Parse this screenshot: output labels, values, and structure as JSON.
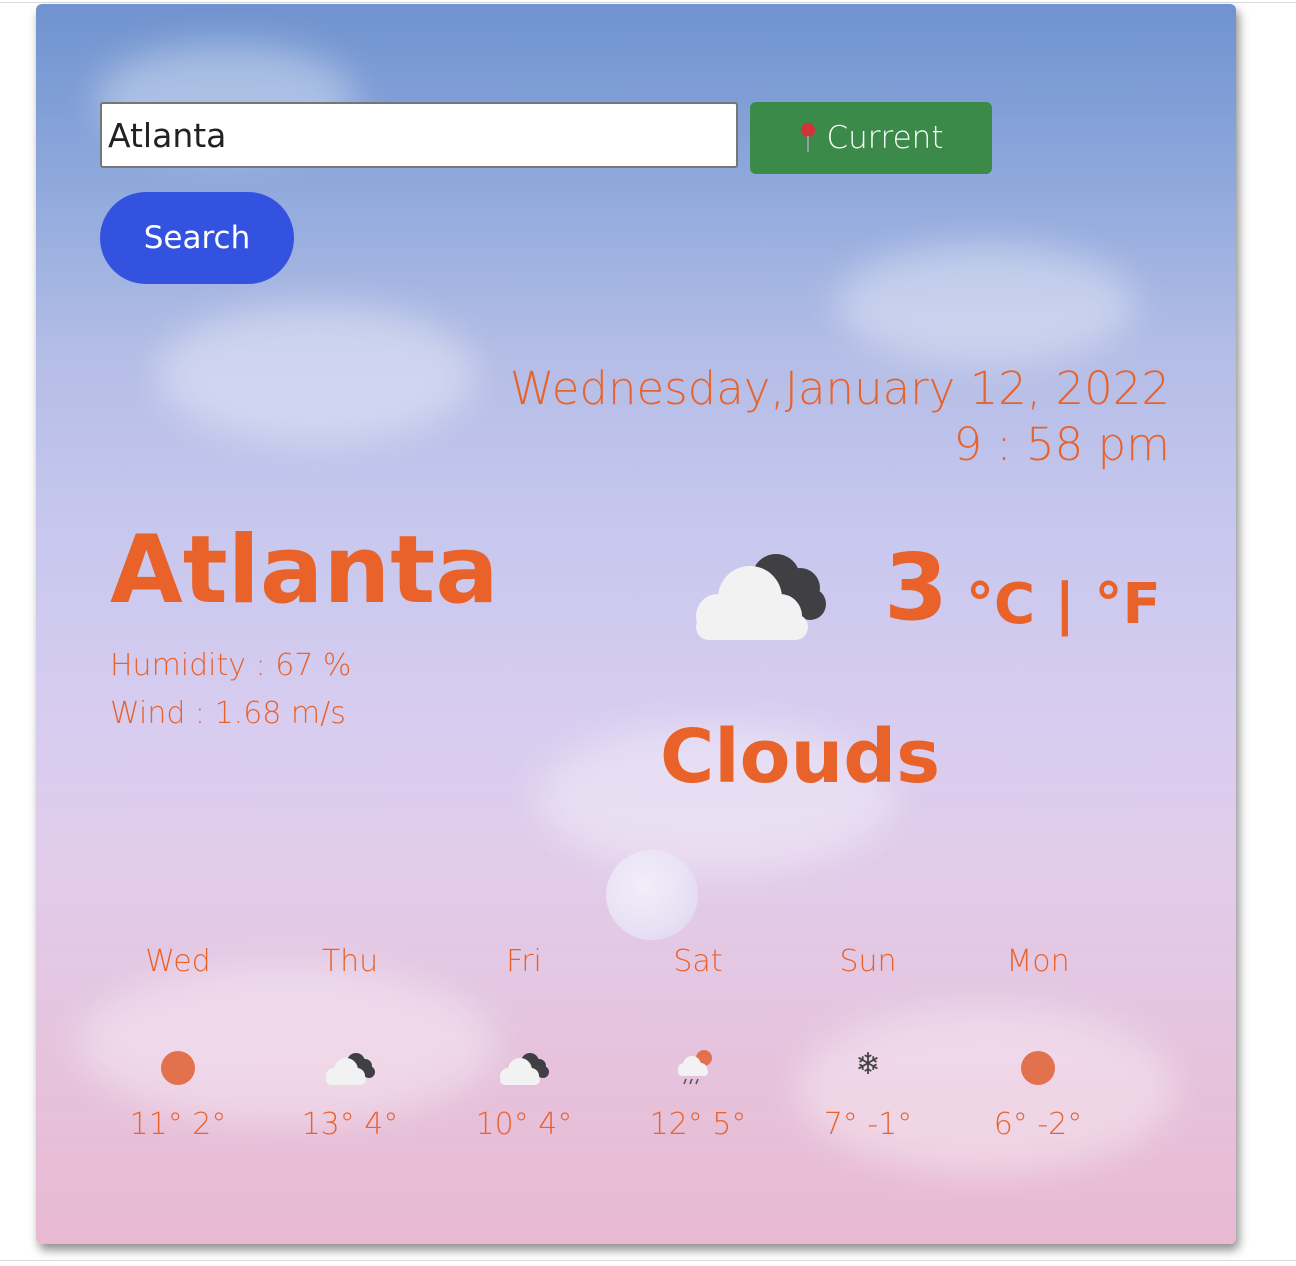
{
  "search": {
    "value": "Atlanta",
    "current_label": "Current",
    "search_label": "Search"
  },
  "datetime": {
    "date": "Wednesday,January 12, 2022",
    "time": "9 : 58 pm"
  },
  "location": {
    "city": "Atlanta",
    "humidity": "Humidity : 67 %",
    "wind": "Wind : 1.68 m/s"
  },
  "current": {
    "temp": "3",
    "units": "°C | °F",
    "condition": "Clouds",
    "icon": "clouds-icon"
  },
  "forecast": [
    {
      "day": "Wed",
      "temps": "11° 2°",
      "icon": "sun-icon"
    },
    {
      "day": "Thu",
      "temps": "13° 4°",
      "icon": "clouds-icon"
    },
    {
      "day": "Fri",
      "temps": "10° 4°",
      "icon": "clouds-icon"
    },
    {
      "day": "Sat",
      "temps": "12° 5°",
      "icon": "rain-icon"
    },
    {
      "day": "Sun",
      "temps": "7° -1°",
      "icon": "snow-icon"
    },
    {
      "day": "Mon",
      "temps": "6° -2°",
      "icon": "sun-icon"
    }
  ],
  "colors": {
    "accent": "#e9622a",
    "search_button": "#3452e0",
    "current_button": "#3b8a4a"
  }
}
